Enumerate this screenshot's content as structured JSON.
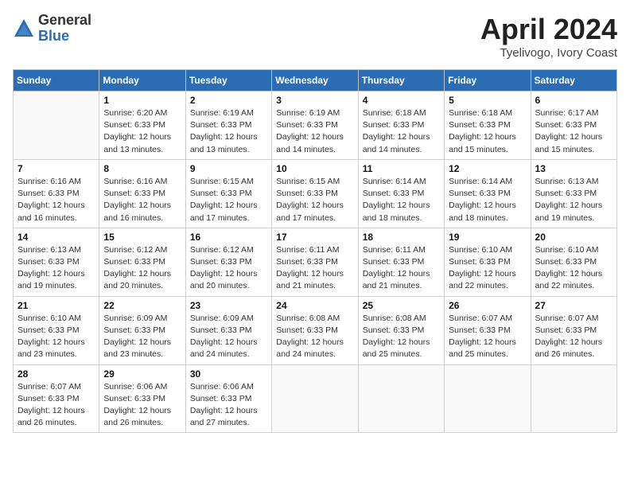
{
  "header": {
    "logo_general": "General",
    "logo_blue": "Blue",
    "month_title": "April 2024",
    "location": "Tyelivogo, Ivory Coast"
  },
  "calendar": {
    "days_of_week": [
      "Sunday",
      "Monday",
      "Tuesday",
      "Wednesday",
      "Thursday",
      "Friday",
      "Saturday"
    ],
    "weeks": [
      [
        {
          "day": "",
          "sunrise": "",
          "sunset": "",
          "daylight": ""
        },
        {
          "day": "1",
          "sunrise": "Sunrise: 6:20 AM",
          "sunset": "Sunset: 6:33 PM",
          "daylight": "Daylight: 12 hours and 13 minutes."
        },
        {
          "day": "2",
          "sunrise": "Sunrise: 6:19 AM",
          "sunset": "Sunset: 6:33 PM",
          "daylight": "Daylight: 12 hours and 13 minutes."
        },
        {
          "day": "3",
          "sunrise": "Sunrise: 6:19 AM",
          "sunset": "Sunset: 6:33 PM",
          "daylight": "Daylight: 12 hours and 14 minutes."
        },
        {
          "day": "4",
          "sunrise": "Sunrise: 6:18 AM",
          "sunset": "Sunset: 6:33 PM",
          "daylight": "Daylight: 12 hours and 14 minutes."
        },
        {
          "day": "5",
          "sunrise": "Sunrise: 6:18 AM",
          "sunset": "Sunset: 6:33 PM",
          "daylight": "Daylight: 12 hours and 15 minutes."
        },
        {
          "day": "6",
          "sunrise": "Sunrise: 6:17 AM",
          "sunset": "Sunset: 6:33 PM",
          "daylight": "Daylight: 12 hours and 15 minutes."
        }
      ],
      [
        {
          "day": "7",
          "sunrise": "Sunrise: 6:16 AM",
          "sunset": "Sunset: 6:33 PM",
          "daylight": "Daylight: 12 hours and 16 minutes."
        },
        {
          "day": "8",
          "sunrise": "Sunrise: 6:16 AM",
          "sunset": "Sunset: 6:33 PM",
          "daylight": "Daylight: 12 hours and 16 minutes."
        },
        {
          "day": "9",
          "sunrise": "Sunrise: 6:15 AM",
          "sunset": "Sunset: 6:33 PM",
          "daylight": "Daylight: 12 hours and 17 minutes."
        },
        {
          "day": "10",
          "sunrise": "Sunrise: 6:15 AM",
          "sunset": "Sunset: 6:33 PM",
          "daylight": "Daylight: 12 hours and 17 minutes."
        },
        {
          "day": "11",
          "sunrise": "Sunrise: 6:14 AM",
          "sunset": "Sunset: 6:33 PM",
          "daylight": "Daylight: 12 hours and 18 minutes."
        },
        {
          "day": "12",
          "sunrise": "Sunrise: 6:14 AM",
          "sunset": "Sunset: 6:33 PM",
          "daylight": "Daylight: 12 hours and 18 minutes."
        },
        {
          "day": "13",
          "sunrise": "Sunrise: 6:13 AM",
          "sunset": "Sunset: 6:33 PM",
          "daylight": "Daylight: 12 hours and 19 minutes."
        }
      ],
      [
        {
          "day": "14",
          "sunrise": "Sunrise: 6:13 AM",
          "sunset": "Sunset: 6:33 PM",
          "daylight": "Daylight: 12 hours and 19 minutes."
        },
        {
          "day": "15",
          "sunrise": "Sunrise: 6:12 AM",
          "sunset": "Sunset: 6:33 PM",
          "daylight": "Daylight: 12 hours and 20 minutes."
        },
        {
          "day": "16",
          "sunrise": "Sunrise: 6:12 AM",
          "sunset": "Sunset: 6:33 PM",
          "daylight": "Daylight: 12 hours and 20 minutes."
        },
        {
          "day": "17",
          "sunrise": "Sunrise: 6:11 AM",
          "sunset": "Sunset: 6:33 PM",
          "daylight": "Daylight: 12 hours and 21 minutes."
        },
        {
          "day": "18",
          "sunrise": "Sunrise: 6:11 AM",
          "sunset": "Sunset: 6:33 PM",
          "daylight": "Daylight: 12 hours and 21 minutes."
        },
        {
          "day": "19",
          "sunrise": "Sunrise: 6:10 AM",
          "sunset": "Sunset: 6:33 PM",
          "daylight": "Daylight: 12 hours and 22 minutes."
        },
        {
          "day": "20",
          "sunrise": "Sunrise: 6:10 AM",
          "sunset": "Sunset: 6:33 PM",
          "daylight": "Daylight: 12 hours and 22 minutes."
        }
      ],
      [
        {
          "day": "21",
          "sunrise": "Sunrise: 6:10 AM",
          "sunset": "Sunset: 6:33 PM",
          "daylight": "Daylight: 12 hours and 23 minutes."
        },
        {
          "day": "22",
          "sunrise": "Sunrise: 6:09 AM",
          "sunset": "Sunset: 6:33 PM",
          "daylight": "Daylight: 12 hours and 23 minutes."
        },
        {
          "day": "23",
          "sunrise": "Sunrise: 6:09 AM",
          "sunset": "Sunset: 6:33 PM",
          "daylight": "Daylight: 12 hours and 24 minutes."
        },
        {
          "day": "24",
          "sunrise": "Sunrise: 6:08 AM",
          "sunset": "Sunset: 6:33 PM",
          "daylight": "Daylight: 12 hours and 24 minutes."
        },
        {
          "day": "25",
          "sunrise": "Sunrise: 6:08 AM",
          "sunset": "Sunset: 6:33 PM",
          "daylight": "Daylight: 12 hours and 25 minutes."
        },
        {
          "day": "26",
          "sunrise": "Sunrise: 6:07 AM",
          "sunset": "Sunset: 6:33 PM",
          "daylight": "Daylight: 12 hours and 25 minutes."
        },
        {
          "day": "27",
          "sunrise": "Sunrise: 6:07 AM",
          "sunset": "Sunset: 6:33 PM",
          "daylight": "Daylight: 12 hours and 26 minutes."
        }
      ],
      [
        {
          "day": "28",
          "sunrise": "Sunrise: 6:07 AM",
          "sunset": "Sunset: 6:33 PM",
          "daylight": "Daylight: 12 hours and 26 minutes."
        },
        {
          "day": "29",
          "sunrise": "Sunrise: 6:06 AM",
          "sunset": "Sunset: 6:33 PM",
          "daylight": "Daylight: 12 hours and 26 minutes."
        },
        {
          "day": "30",
          "sunrise": "Sunrise: 6:06 AM",
          "sunset": "Sunset: 6:33 PM",
          "daylight": "Daylight: 12 hours and 27 minutes."
        },
        {
          "day": "",
          "sunrise": "",
          "sunset": "",
          "daylight": ""
        },
        {
          "day": "",
          "sunrise": "",
          "sunset": "",
          "daylight": ""
        },
        {
          "day": "",
          "sunrise": "",
          "sunset": "",
          "daylight": ""
        },
        {
          "day": "",
          "sunrise": "",
          "sunset": "",
          "daylight": ""
        }
      ]
    ]
  }
}
